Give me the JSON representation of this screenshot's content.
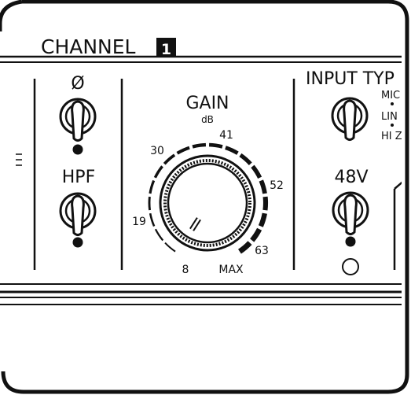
{
  "panel": {
    "channel_label": "CHANNEL",
    "channel_number": "1"
  },
  "left_column": {
    "phase_label": "Ø",
    "hpf_label": "HPF"
  },
  "gain": {
    "title": "GAIN",
    "unit": "dB",
    "scale": [
      "8",
      "19",
      "30",
      "41",
      "52",
      "63",
      "MAX"
    ]
  },
  "input_type": {
    "title": "INPUT TYP",
    "options": [
      "MIC",
      "LIN",
      "HI Z"
    ]
  },
  "phantom": {
    "label": "48V"
  },
  "colors": {
    "ink": "#111111",
    "background": "#ffffff"
  }
}
